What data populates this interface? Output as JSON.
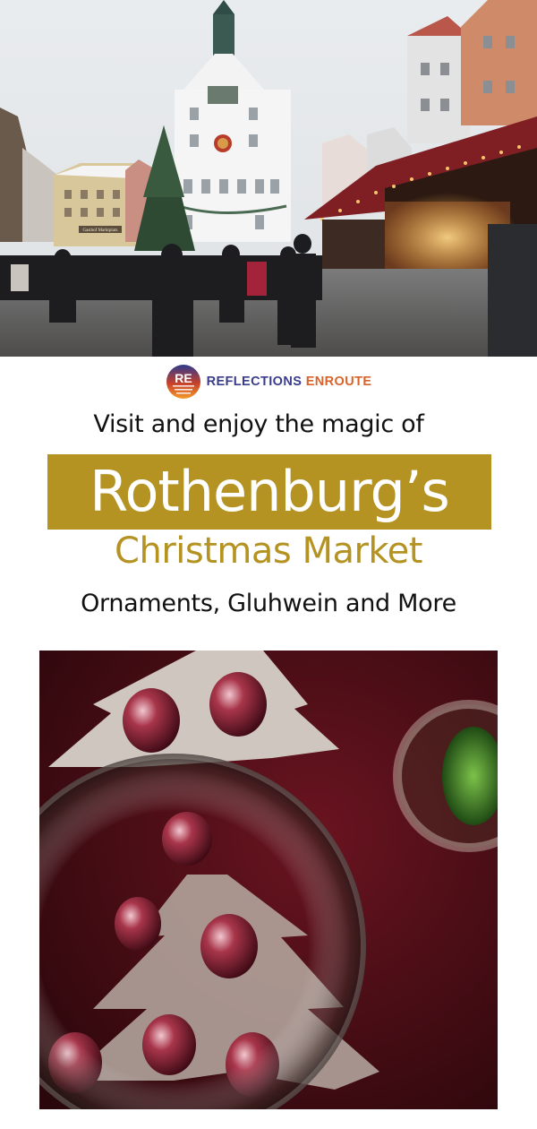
{
  "header_photo": {
    "alt": "Christmas market square with clock tower and decorated stalls",
    "sign_text": "Gasthof Marktplatz"
  },
  "brand": {
    "logo_letters": "RE",
    "name_part1": "REFLECTIONS ",
    "name_part2": "ENROUTE",
    "colors": {
      "primary": "#3b3d8c",
      "accent": "#d8632a"
    }
  },
  "headline": {
    "intro": "Visit and enjoy the magic of",
    "title": "Rothenburg’s",
    "subtitle": "Christmas Market",
    "tagline": "Ornaments, Gluhwein and More"
  },
  "theme": {
    "gold": "#b59322",
    "text": "#111111"
  },
  "footer_photo": {
    "alt": "Metal tree ornaments holding red glass baubles seen through a glass"
  }
}
